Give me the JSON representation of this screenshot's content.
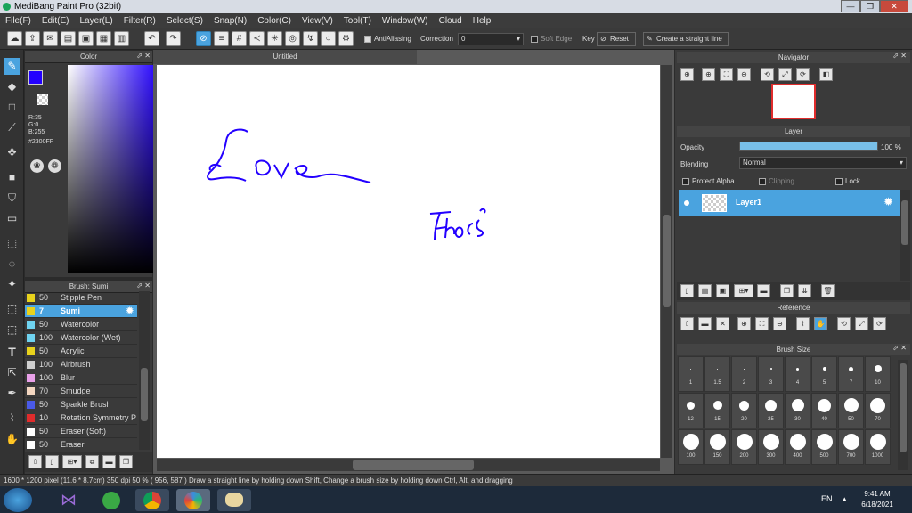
{
  "window": {
    "title": "MediBang Paint Pro (32bit)"
  },
  "menu": [
    "File(F)",
    "Edit(E)",
    "Layer(L)",
    "Filter(R)",
    "Select(S)",
    "Snap(N)",
    "Color(C)",
    "View(V)",
    "Tool(T)",
    "Window(W)",
    "Cloud",
    "Help"
  ],
  "toolbar": {
    "antialiasing": "AntiAliasing",
    "correction_label": "Correction",
    "correction_value": "0",
    "soft_edge": "Soft Edge",
    "key": "Key",
    "reset": "Reset",
    "straight_line": "Create a straight line"
  },
  "color": {
    "title": "Color",
    "r": "R:35",
    "g": "G:0",
    "b": "B:255",
    "hex": "#2300FF",
    "fg": "#2300ff"
  },
  "brush": {
    "title": "Brush: Sumi",
    "items": [
      {
        "size": "50",
        "name": "Stipple Pen",
        "color": "#e8d21c"
      },
      {
        "size": "7",
        "name": "Sumi",
        "color": "#e8d21c",
        "selected": true
      },
      {
        "size": "50",
        "name": "Watercolor",
        "color": "#6fd3f0"
      },
      {
        "size": "100",
        "name": "Watercolor (Wet)",
        "color": "#6fd3f0"
      },
      {
        "size": "50",
        "name": "Acrylic",
        "color": "#e8d21c"
      },
      {
        "size": "100",
        "name": "Airbrush",
        "color": "#cfcfcf"
      },
      {
        "size": "100",
        "name": "Blur",
        "color": "#e9a0e9"
      },
      {
        "size": "70",
        "name": "Smudge",
        "color": "#f3d6c0"
      },
      {
        "size": "50",
        "name": "Sparkle Brush",
        "color": "#4a5ae8"
      },
      {
        "size": "10",
        "name": "Rotation Symmetry P",
        "color": "#e02c2c"
      },
      {
        "size": "50",
        "name": "Eraser (Soft)",
        "color": "#ffffff"
      },
      {
        "size": "50",
        "name": "Eraser",
        "color": "#ffffff"
      }
    ]
  },
  "canvas": {
    "tab": "Untitled",
    "text1": "Love",
    "text2": "Fhocs"
  },
  "navigator": {
    "title": "Navigator"
  },
  "layer": {
    "title": "Layer",
    "opacity_label": "Opacity",
    "opacity_value": "100 %",
    "opacity": 1.0,
    "blending_label": "Blending",
    "blending_value": "Normal",
    "protect_alpha": "Protect Alpha",
    "clipping": "Clipping",
    "lock": "Lock",
    "layer_name": "Layer1"
  },
  "reference": {
    "title": "Reference"
  },
  "brush_size": {
    "title": "Brush Size",
    "row1": [
      "1",
      "1.5",
      "2",
      "3",
      "4",
      "5",
      "7",
      "10"
    ],
    "row2": [
      "12",
      "15",
      "20",
      "25",
      "30",
      "40",
      "50",
      "70"
    ],
    "row3": [
      "100",
      "150",
      "200",
      "300",
      "400",
      "500",
      "700",
      "1000"
    ]
  },
  "status": {
    "size": "1600 * 1200 pixel  (11.6 * 8.7cm)  350 dpi  50 %  ( 956, 587 )  Draw a straight line by holding down Shift, Change a brush size by holding down Ctrl, Alt, and dragging"
  },
  "taskbar": {
    "lang": "EN",
    "time": "9:41 AM",
    "date": "6/18/2021"
  }
}
